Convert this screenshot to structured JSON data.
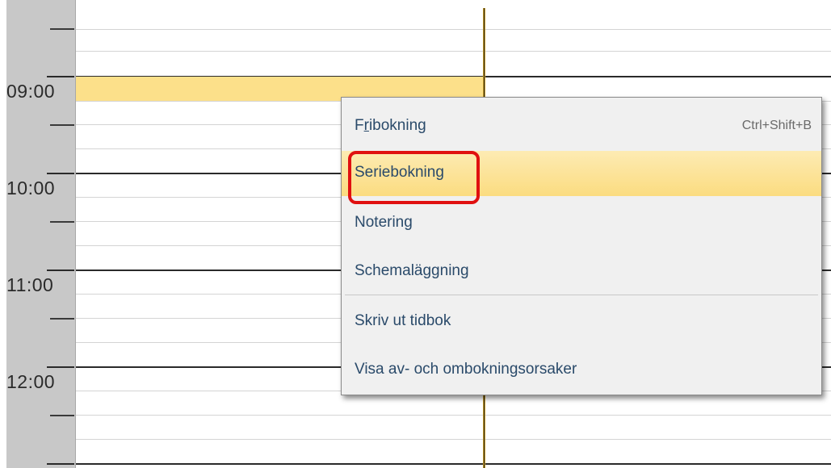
{
  "calendar": {
    "time_labels": [
      "09:00",
      "10:00",
      "11:00",
      "12:00"
    ]
  },
  "context_menu": {
    "items": [
      {
        "label": "Fribokning",
        "mnemonic_char": "r",
        "shortcut": "Ctrl+Shift+B"
      },
      {
        "label": "Seriebokning"
      },
      {
        "label": "Notering"
      },
      {
        "label": "Schemaläggning"
      },
      {
        "label": "Skriv ut tidbok"
      },
      {
        "label": "Visa av- och ombokningsorsaker"
      }
    ],
    "highlighted_item": "Seriebokning"
  },
  "colors": {
    "selected_slot": "#fce08a",
    "menu_highlight": "#fbdc80",
    "annotation_box": "#e01010",
    "menu_text": "#2a4a6a"
  }
}
